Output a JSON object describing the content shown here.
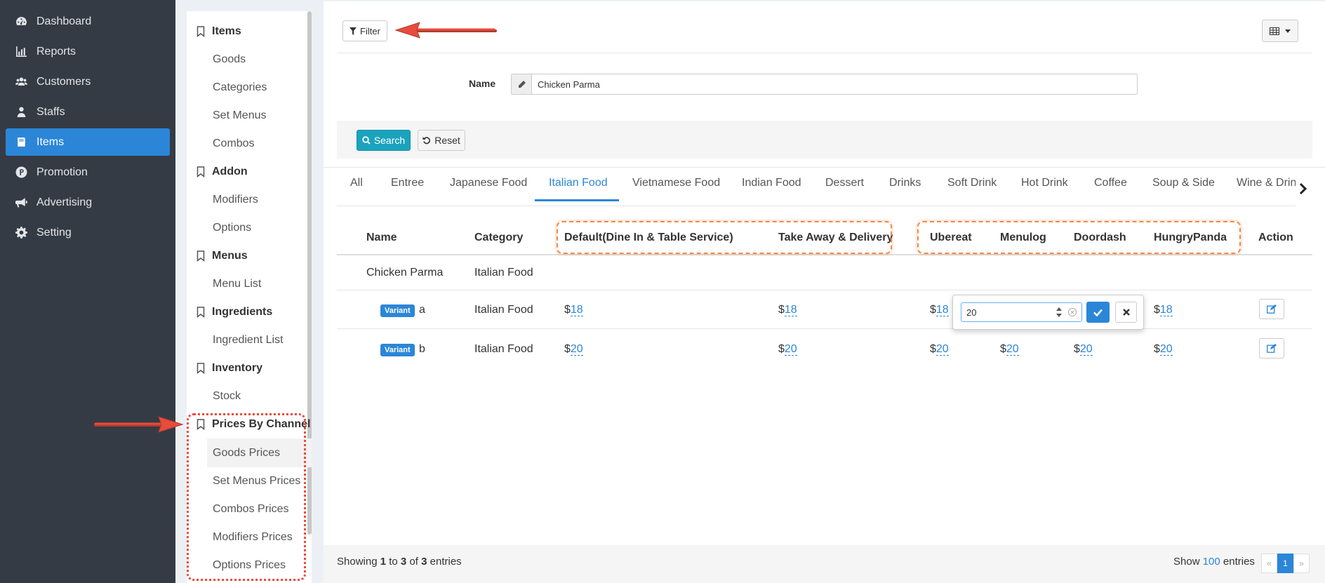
{
  "mainnav": {
    "items": [
      {
        "label": "Dashboard",
        "icon": "dashboard-icon"
      },
      {
        "label": "Reports",
        "icon": "bar-chart-icon"
      },
      {
        "label": "Customers",
        "icon": "users-icon"
      },
      {
        "label": "Staffs",
        "icon": "user-tie-icon"
      },
      {
        "label": "Items",
        "icon": "book-icon",
        "active": true
      },
      {
        "label": "Promotion",
        "icon": "promotion-p-icon"
      },
      {
        "label": "Advertising",
        "icon": "bullhorn-icon"
      },
      {
        "label": "Setting",
        "icon": "gear-icon"
      }
    ]
  },
  "subnav": {
    "items_head": "Items",
    "items": [
      "Goods",
      "Categories",
      "Set Menus",
      "Combos"
    ],
    "addon_head": "Addon",
    "addon": [
      "Modifiers",
      "Options"
    ],
    "menus_head": "Menus",
    "menus": [
      "Menu List"
    ],
    "ingredients_head": "Ingredients",
    "ingredients": [
      "Ingredient List"
    ],
    "inventory_head": "Inventory",
    "inventory": [
      "Stock"
    ],
    "prices_head": "Prices By Channel",
    "prices": [
      "Goods Prices",
      "Set Menus Prices",
      "Combos Prices",
      "Modifiers Prices",
      "Options Prices"
    ]
  },
  "toolbar": {
    "filter_label": "Filter"
  },
  "filter": {
    "name_label": "Name",
    "name_value": "Chicken Parma",
    "search_label": "Search",
    "reset_label": "Reset"
  },
  "tabs": [
    "All",
    "Entree",
    "Japanese Food",
    "Italian Food",
    "Vietnamese Food",
    "Indian Food",
    "Dessert",
    "Drinks",
    "Soft Drink",
    "Hot Drink",
    "Coffee",
    "Soup & Side",
    "Wine & Drink"
  ],
  "active_tab": "Italian Food",
  "table": {
    "headers": {
      "name": "Name",
      "category": "Category",
      "default": "Default(Dine In & Table Service)",
      "takeaway": "Take Away & Delivery",
      "ubereat": "Ubereat",
      "menulog": "Menulog",
      "doordash": "Doordash",
      "hungrypanda": "HungryPanda",
      "action": "Action"
    },
    "parent_row": {
      "name": "Chicken Parma",
      "category": "Italian Food"
    },
    "variant_badge": "Variant",
    "currency": "$",
    "rows": [
      {
        "name": "a",
        "category": "Italian Food",
        "default": "18",
        "takeaway": "18",
        "ubereat": "18",
        "menulog": "",
        "doordash": "",
        "hungrypanda": "18"
      },
      {
        "name": "b",
        "category": "Italian Food",
        "default": "20",
        "takeaway": "20",
        "ubereat": "20",
        "menulog": "20",
        "doordash": "20",
        "hungrypanda": "20"
      }
    ]
  },
  "editor": {
    "value": "20"
  },
  "footer": {
    "showing_prefix": "Showing",
    "from": "1",
    "to_word": "to",
    "to": "3",
    "of_word": "of",
    "total": "3",
    "entries_word": "entries",
    "show_label": "Show",
    "page_size": "100",
    "show_entries_word": "entries",
    "prev": "«",
    "current_page": "1",
    "next": "»"
  },
  "colors": {
    "sidebar_bg": "#353b44",
    "accent": "#2b86d8",
    "search_btn": "#1ba3bd",
    "annotation_red": "#e74c3c",
    "annotation_orange": "#f08a4b"
  }
}
